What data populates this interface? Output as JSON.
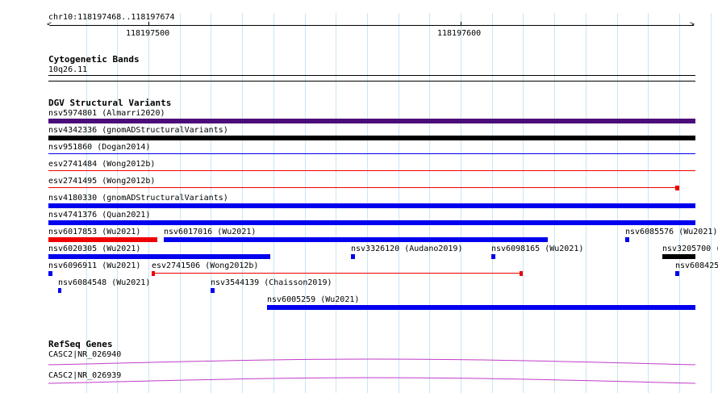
{
  "ruler": {
    "location": "chr10:118197468..118197674",
    "tick_labels": [
      "118197500",
      "118197600"
    ]
  },
  "cytoband": {
    "title": "Cytogenetic Bands",
    "band": "10q26.11"
  },
  "dgv": {
    "title": "DGV Structural Variants",
    "labels": {
      "nsv5974801": "nsv5974801 (Almarri2020)",
      "nsv4342336": "nsv4342336 (gnomADStructuralVariants)",
      "nsv951860": "nsv951860 (Dogan2014)",
      "esv2741484": "esv2741484 (Wong2012b)",
      "esv2741495": "esv2741495 (Wong2012b)",
      "nsv4180330": "nsv4180330 (gnomADStructuralVariants)",
      "nsv4741376": "nsv4741376 (Quan2021)",
      "nsv6017853": "nsv6017853 (Wu2021)",
      "nsv6017016": "nsv6017016 (Wu2021)",
      "nsv6085576": "nsv6085576 (Wu2021)",
      "nsv6020305": "nsv6020305 (Wu2021)",
      "nsv3326120": "nsv3326120 (Audano2019)",
      "nsv6098165": "nsv6098165 (Wu2021)",
      "nsv3205700": "nsv3205700 (",
      "nsv6096911": "nsv6096911 (Wu2021)",
      "esv2741506": "esv2741506 (Wong2012b)",
      "nsv608425": "nsv608425",
      "nsv6084548": "nsv6084548 (Wu2021)",
      "nsv3544139": "nsv3544139 (Chaisson2019)",
      "nsv6005259": "nsv6005259 (Wu2021)"
    }
  },
  "refseq": {
    "title": "RefSeq Genes",
    "genes": [
      "CASC2|NR_026940",
      "CASC2|NR_026939"
    ]
  },
  "colors": {
    "grid": "#c8e6f3",
    "purple_dark": "#4b0d7a",
    "black": "#000000",
    "blue": "#0000ee",
    "red": "#ee0000",
    "gene": "#c03cc8"
  }
}
